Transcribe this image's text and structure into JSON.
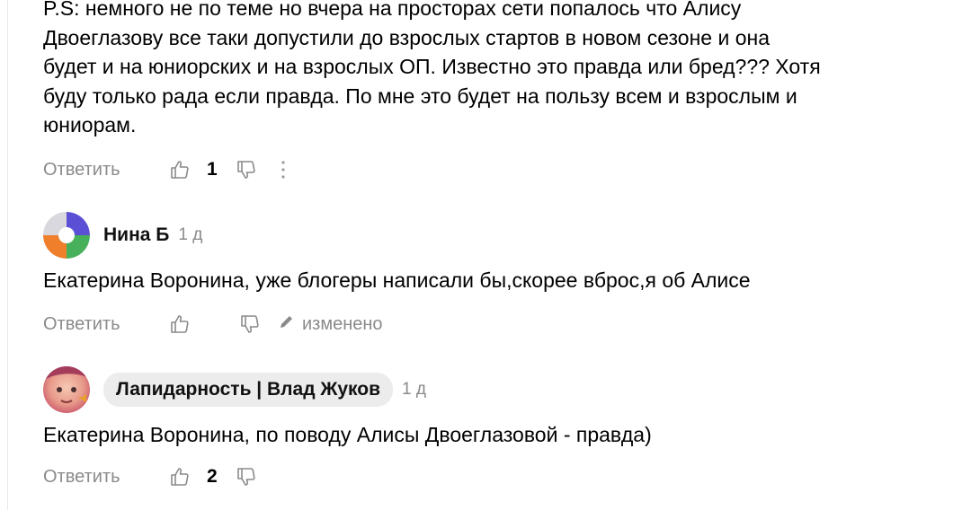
{
  "comments": [
    {
      "text": "P.S: немного не по теме но вчера на просторах сети попалось что Алису\nДвоеглазову все таки допустили до взрослых стартов в новом сезоне и она\nбудет и на юниорских и на взрослых ОП. Известно это правда или бред??? Хотя\nбуду только рада если правда. По мне это будет на пользу всем и взрослым и\nюниорам.",
      "reply_label": "Ответить",
      "likes": "1",
      "more_icon": "kebab-vertical-icon"
    },
    {
      "author": "Нина Б",
      "age": "1 д",
      "text": "Екатерина Воронина, уже блогеры написали бы,скорее вброс,я об Алисе",
      "reply_label": "Ответить",
      "edited_label": "изменено",
      "avatar_colors": [
        "#5b4fd6",
        "#47b05a",
        "#f07f2c",
        "#d8d8de"
      ]
    },
    {
      "author": "Лапидарность | Влад Жуков",
      "age": "1 д",
      "text": "Екатерина Воронина, по поводу Алисы Двоеглазовой - правда)",
      "reply_label": "Ответить",
      "likes": "2"
    }
  ]
}
